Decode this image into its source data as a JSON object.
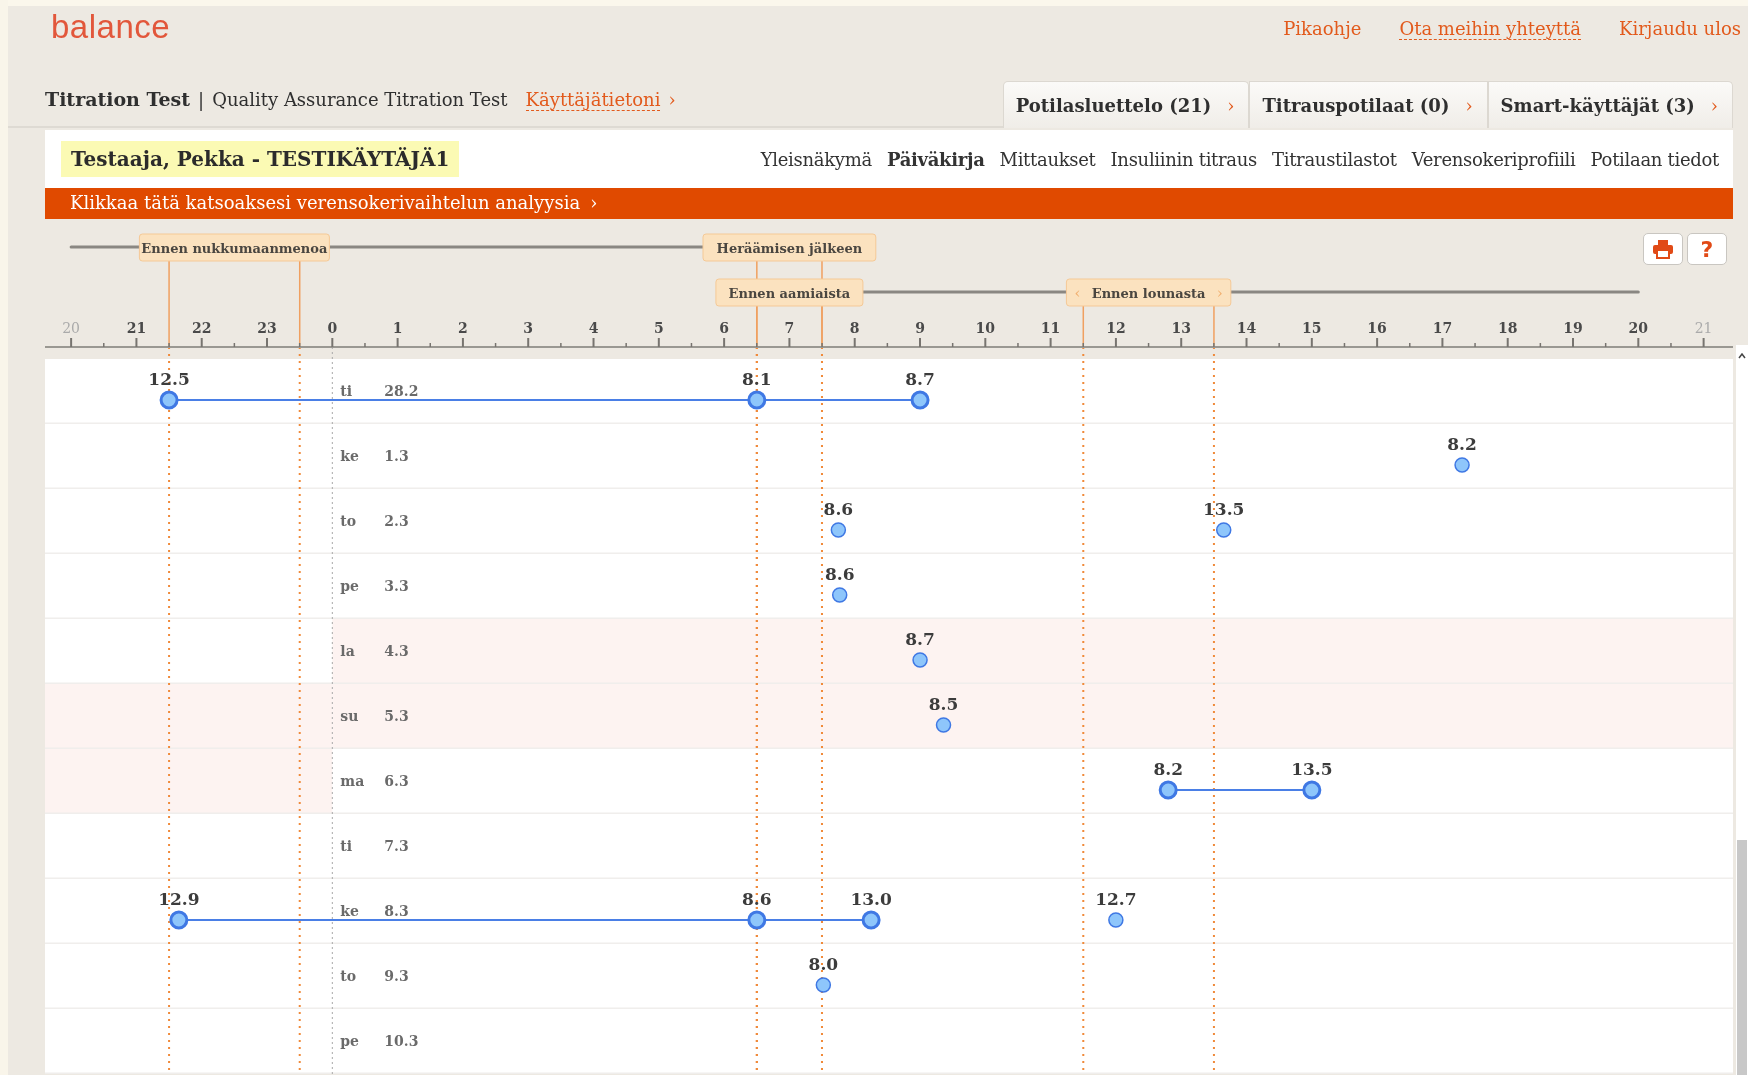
{
  "header": {
    "logo": "balance",
    "links": [
      {
        "label": "Pikaohje",
        "dashed": false
      },
      {
        "label": "Ota meihin yhteyttä",
        "dashed": true
      },
      {
        "label": "Kirjaudu ulos",
        "dashed": false
      }
    ]
  },
  "account": {
    "name": "Titration Test",
    "separator": "|",
    "organization": "Quality Assurance Titration Test",
    "profile_link": "Käyttäjätietoni",
    "chevron": "›"
  },
  "tabs": [
    {
      "label": "Potilasluettelo (21)",
      "chevron": "›",
      "selected": false
    },
    {
      "label": "Titrauspotilaat (0)",
      "chevron": "›",
      "selected": false
    },
    {
      "label": "Smart-käyttäjät (3)",
      "chevron": "›",
      "selected": false
    }
  ],
  "patient": {
    "name": "Testaaja, Pekka - TESTIKÄYTÄJÄ1"
  },
  "nav": [
    {
      "label": "Yleisnäkymä",
      "selected": false
    },
    {
      "label": "Päiväkirja",
      "selected": true
    },
    {
      "label": "Mittaukset",
      "selected": false
    },
    {
      "label": "Insuliinin titraus",
      "selected": false
    },
    {
      "label": "Titraustilastot",
      "selected": false
    },
    {
      "label": "Verensokeriprofiili",
      "selected": false
    },
    {
      "label": "Potilaan tiedot",
      "selected": false
    }
  ],
  "banner": {
    "text": "Klikkaa tätä katsoaksesi verensokerivaihtelun analyysia",
    "chevron": "›"
  },
  "toolbar": {
    "help": "?"
  },
  "diary": {
    "hours": [
      "20",
      "21",
      "22",
      "23",
      "0",
      "1",
      "2",
      "3",
      "4",
      "5",
      "6",
      "7",
      "8",
      "9",
      "10",
      "11",
      "12",
      "13",
      "14",
      "15",
      "16",
      "17",
      "18",
      "19",
      "20",
      "21"
    ],
    "periods": [
      {
        "label": "Ennen nukkumaanmenoa",
        "kind": "upper",
        "edges": [
          {
            "level": 0.0735
          },
          {
            "level": 0.1509
          }
        ]
      },
      {
        "label": "Heräämisen jälkeen",
        "kind": "upper",
        "edges": [
          {
            "level": 0.4217
          },
          {
            "level": 0.4603
          }
        ]
      },
      {
        "label": "Ennen aamiaista",
        "kind": "lower",
        "edges": [
          {
            "level": 0.4217
          },
          {
            "level": 0.4603
          }
        ]
      },
      {
        "label": "Ennen lounasta",
        "kind": "lower",
        "arrows": [
          "‹",
          "›"
        ],
        "edges": [
          {
            "level": 0.6151
          },
          {
            "level": 0.6925
          }
        ]
      }
    ],
    "days": [
      {
        "weekday": "ti",
        "date": "28.2",
        "weekend": false,
        "readings": [
          {
            "value": "12.5",
            "level": 0.0735,
            "joined": true
          },
          {
            "value": "8.1",
            "level": 0.4217,
            "joined": true
          },
          {
            "value": "8.7",
            "level": 0.5184,
            "joined": true
          }
        ]
      },
      {
        "weekday": "ke",
        "date": "1.3",
        "weekend": false,
        "readings": [
          {
            "value": "8.2",
            "level": 0.8395,
            "joined": false
          }
        ]
      },
      {
        "weekday": "to",
        "date": "2.3",
        "weekend": false,
        "readings": [
          {
            "value": "8.6",
            "level": 0.47,
            "joined": false
          },
          {
            "value": "13.5",
            "level": 0.6983,
            "joined": false
          }
        ]
      },
      {
        "weekday": "pe",
        "date": "3.3",
        "weekend": false,
        "readings": [
          {
            "value": "8.6",
            "level": 0.4708,
            "joined": false
          }
        ]
      },
      {
        "weekday": "la",
        "date": "4.3",
        "weekend": true,
        "readings": [
          {
            "value": "8.7",
            "level": 0.5184,
            "joined": false
          }
        ]
      },
      {
        "weekday": "su",
        "date": "5.3",
        "weekend": true,
        "readings": [
          {
            "value": "8.5",
            "level": 0.5323,
            "joined": false
          }
        ]
      },
      {
        "weekday": "ma",
        "date": "6.3",
        "weekend": false,
        "readings": [
          {
            "value": "8.2",
            "level": 0.6654,
            "joined": true
          },
          {
            "value": "13.5",
            "level": 0.7505,
            "joined": true
          }
        ]
      },
      {
        "weekday": "ti",
        "date": "7.3",
        "weekend": false
      },
      {
        "weekday": "ke",
        "date": "8.3",
        "weekend": false,
        "readings": [
          {
            "value": "12.9",
            "level": 0.0793,
            "joined": true
          },
          {
            "value": "8.6",
            "level": 0.4217,
            "joined": true
          },
          {
            "value": "13.0",
            "level": 0.4894,
            "joined": true
          },
          {
            "value": "12.7",
            "level": 0.6344,
            "joined": false
          }
        ]
      },
      {
        "weekday": "to",
        "date": "9.3",
        "weekend": false,
        "readings": [
          {
            "value": "8.0",
            "level": 0.4611,
            "joined": false
          }
        ]
      },
      {
        "weekday": "pe",
        "date": "10.3",
        "weekend": false
      }
    ]
  }
}
